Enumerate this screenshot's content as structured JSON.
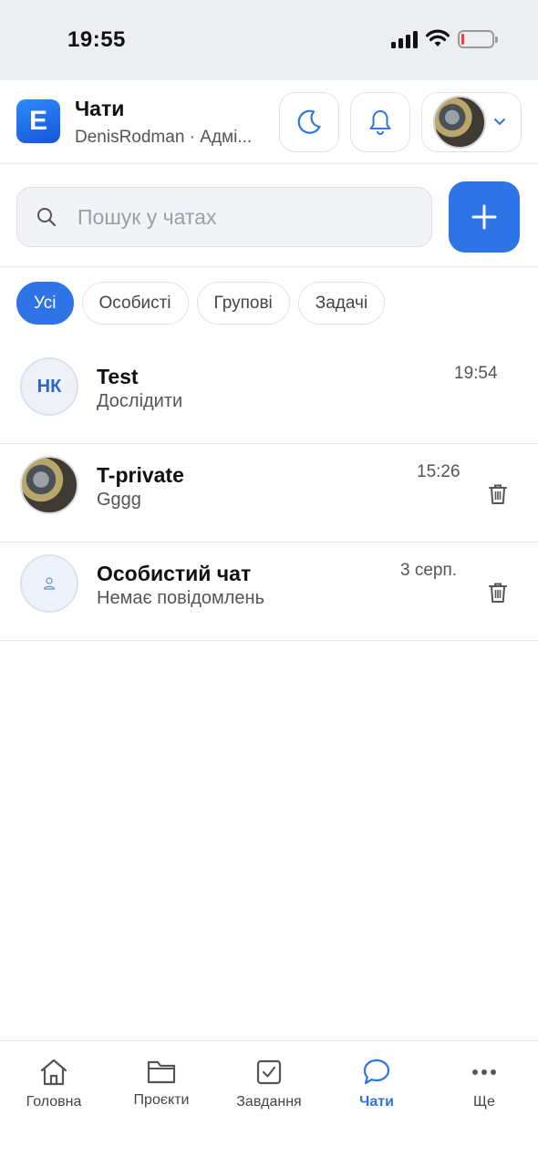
{
  "status_bar": {
    "time": "19:55",
    "battery_percent": 10
  },
  "header": {
    "title": "Чати",
    "subtitle": "DenisRodman · Адмі...",
    "logo_letter": "E",
    "theme_icon": "moon-icon",
    "bell_icon": "bell-icon"
  },
  "search": {
    "placeholder": "Пошук у чатах",
    "value": ""
  },
  "filters": [
    {
      "label": "Усі",
      "active": true
    },
    {
      "label": "Особисті",
      "active": false
    },
    {
      "label": "Групові",
      "active": false
    },
    {
      "label": "Задачі",
      "active": false
    }
  ],
  "chats": [
    {
      "name": "Test",
      "last_message": "Дослідити",
      "time": "19:54",
      "avatar": "НК",
      "deletable": false
    },
    {
      "name": "T-private",
      "last_message": "Gggg",
      "time": "15:26",
      "avatar": "photo",
      "deletable": true
    },
    {
      "name": "Особистий чат",
      "last_message": "Немає повідомлень",
      "time": "3 серп.",
      "avatar": "person-icon",
      "deletable": true
    }
  ],
  "bottom_nav": [
    {
      "label": "Головна",
      "icon": "home-icon",
      "active": false
    },
    {
      "label": "Проєкти",
      "icon": "folder-icon",
      "active": false
    },
    {
      "label": "Завдання",
      "icon": "checkbox-icon",
      "active": false
    },
    {
      "label": "Чати",
      "icon": "chat-icon",
      "active": true
    },
    {
      "label": "Ще",
      "icon": "more-icon",
      "active": false
    }
  ],
  "colors": {
    "accent": "#2f74e6",
    "battery_low": "#ff3b30"
  }
}
